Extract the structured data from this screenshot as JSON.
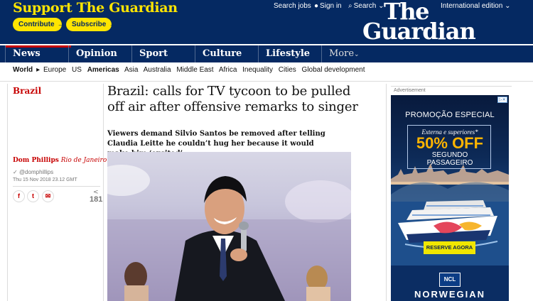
{
  "header": {
    "support_title": "Support The Guardian",
    "contribute_label": "Contribute",
    "subscribe_label": "Subscribe",
    "search_jobs": "Search jobs",
    "sign_in": "Sign in",
    "search": "Search",
    "international": "International edition",
    "logo_line1": "The",
    "logo_line2": "Guardian"
  },
  "pillars": [
    {
      "label": "News",
      "active": true
    },
    {
      "label": "Opinion"
    },
    {
      "label": "Sport"
    },
    {
      "label": "Culture"
    },
    {
      "label": "Lifestyle"
    },
    {
      "label": "More"
    }
  ],
  "subnav": [
    "World",
    "Europe",
    "US",
    "Americas",
    "Asia",
    "Australia",
    "Middle East",
    "Africa",
    "Inequality",
    "Cities",
    "Global development"
  ],
  "article": {
    "section": "Brazil",
    "headline": "Brazil: calls for TV tycoon to be pulled off air after offensive remarks to singer",
    "standfirst": "Viewers demand Silvio Santos be removed after telling Claudia Leitte he couldn’t hug her because it would make him ‘excited’",
    "author": "Dom Phillips",
    "location": "Rio de Janeiro",
    "twitter": "@domphillips",
    "date": "Thu 15 Nov 2018 23.12 GMT",
    "share_count": "181"
  },
  "ad": {
    "label": "Advertisement",
    "promo": "PROMOÇÃO ESPECIAL",
    "sub": "Externa e superiores*",
    "offer": "50% OFF",
    "seg1": "SEGUNDO",
    "seg2": "PASSAGEIRO",
    "button": "RESERVE AGORA",
    "ncl": "NCL",
    "brand": "NORWEGIAN"
  },
  "colors": {
    "brand_navy": "#052962",
    "support_yellow": "#ffe500",
    "news_red": "#c70000"
  }
}
